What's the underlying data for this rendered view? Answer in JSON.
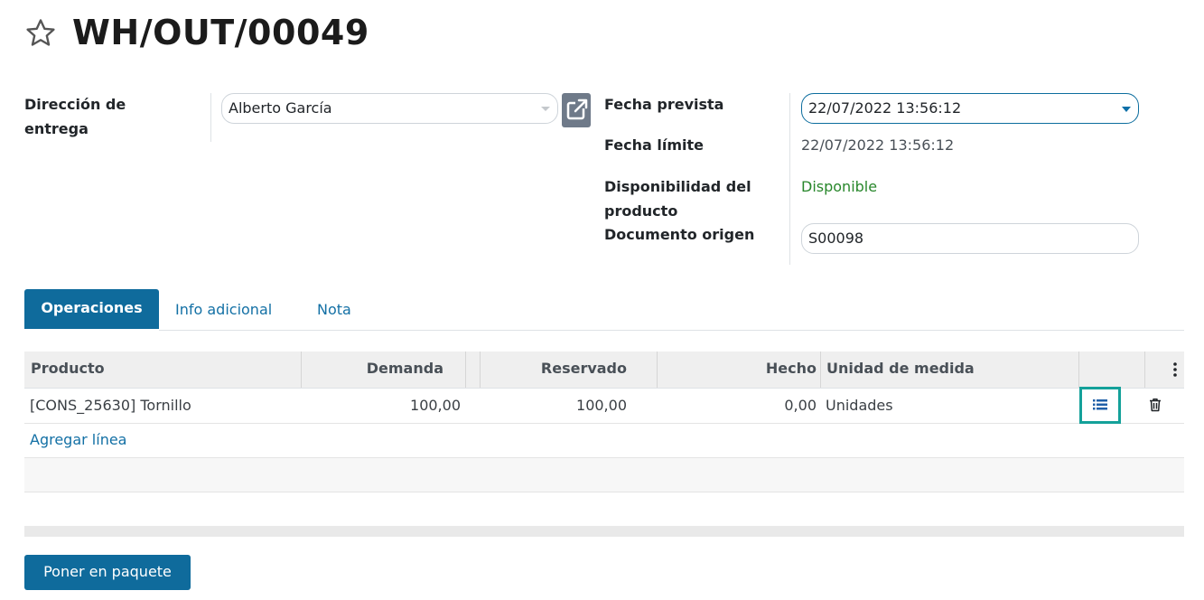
{
  "header": {
    "title": "WH/OUT/00049",
    "favorite_icon": "star-outline-icon"
  },
  "form": {
    "delivery_address_label_line1": "Dirección de",
    "delivery_address_label_line2": "entrega",
    "delivery_address_value": "Alberto García",
    "scheduled_date_label": "Fecha prevista",
    "scheduled_date_value": "22/07/2022 13:56:12",
    "deadline_label": "Fecha límite",
    "deadline_value": "22/07/2022 13:56:12",
    "availability_label_line1": "Disponibilidad del",
    "availability_label_line2": "producto",
    "availability_value": "Disponible",
    "source_document_label": "Documento origen",
    "source_document_value": "S00098"
  },
  "tabs": [
    {
      "label": "Operaciones",
      "active": true
    },
    {
      "label": "Info adicional",
      "active": false
    },
    {
      "label": "Nota",
      "active": false
    }
  ],
  "table": {
    "columns": [
      "Producto",
      "Demanda",
      "Reservado",
      "Hecho",
      "Unidad de medida"
    ],
    "rows": [
      {
        "product": "[CONS_25630] Tornillo",
        "demand": "100,00",
        "reserved": "100,00",
        "done": "0,00",
        "uom": "Unidades"
      }
    ],
    "add_line_label": "Agregar línea"
  },
  "actions": {
    "put_in_pack_label": "Poner en paquete"
  },
  "colors": {
    "primary": "#0f6b9c",
    "link": "#1370a5",
    "success": "#28872b",
    "highlight": "#14a19a"
  }
}
